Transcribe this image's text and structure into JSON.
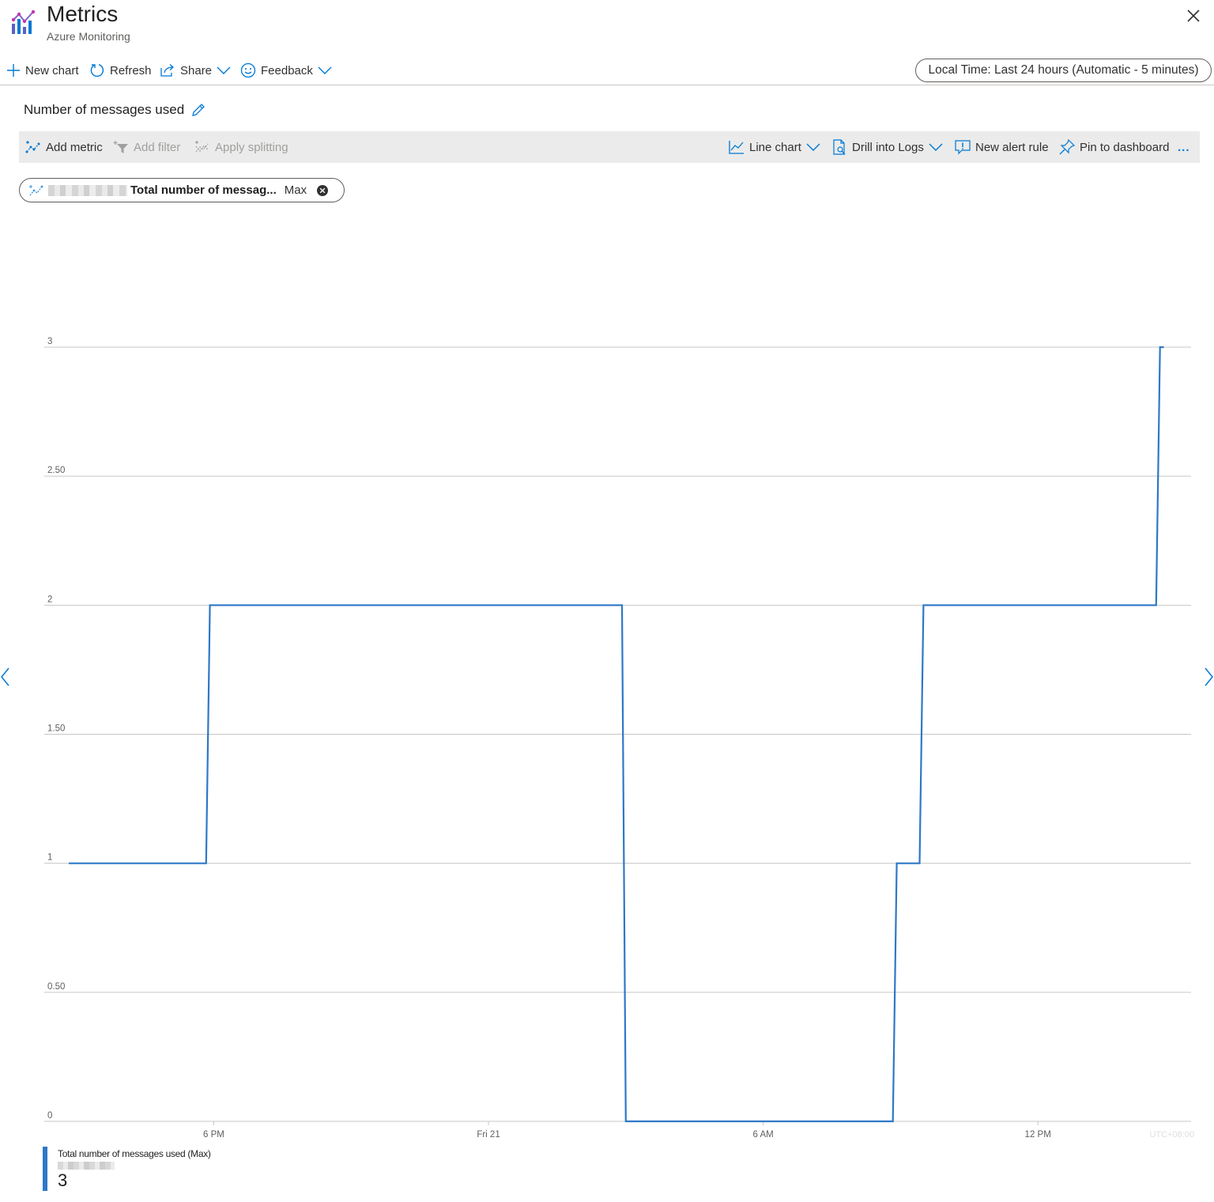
{
  "header": {
    "title": "Metrics",
    "subtitle": "Azure Monitoring"
  },
  "commands": {
    "new_chart": "New chart",
    "refresh": "Refresh",
    "share": "Share",
    "feedback": "Feedback",
    "time_range": "Local Time: Last 24 hours (Automatic - 5 minutes)"
  },
  "chart_title": "Number of messages used",
  "toolbar": {
    "add_metric": "Add metric",
    "add_filter": "Add filter",
    "apply_splitting": "Apply splitting",
    "line_chart": "Line chart",
    "drill_into_logs": "Drill into Logs",
    "new_alert_rule": "New alert rule",
    "pin_to_dashboard": "Pin to dashboard",
    "more": "..."
  },
  "metric_pill": {
    "metric": "Total number of messag...",
    "aggregation": "Max"
  },
  "colors": {
    "series": "#2e78c7",
    "gridline": "#c8c6c4",
    "accent": "#0078d4"
  },
  "chart_data": {
    "type": "line",
    "title": "Number of messages used",
    "xlabel": "",
    "ylabel": "",
    "x_ticks": [
      "6 PM",
      "Fri 21",
      "6 AM",
      "12 PM"
    ],
    "y_ticks": [
      "0",
      "0.50",
      "1",
      "1.50",
      "2",
      "2.50",
      "3"
    ],
    "ylim": [
      0,
      3
    ],
    "timezone_label": "UTC+08:00",
    "grid": true,
    "step": true,
    "series": [
      {
        "name": "Total number of messages used (Max)",
        "color": "#2e78c7",
        "points": [
          {
            "t": "2:50 PM",
            "v": 1
          },
          {
            "t": "5:50 PM",
            "v": 1
          },
          {
            "t": "5:55 PM",
            "v": 2
          },
          {
            "t": "2:55 AM",
            "v": 2
          },
          {
            "t": "3:00 AM",
            "v": 0
          },
          {
            "t": "8:50 AM",
            "v": 0
          },
          {
            "t": "8:55 AM",
            "v": 1
          },
          {
            "t": "9:25 AM",
            "v": 1
          },
          {
            "t": "9:30 AM",
            "v": 2
          },
          {
            "t": "2:35 PM",
            "v": 2
          },
          {
            "t": "2:40 PM",
            "v": 3
          },
          {
            "t": "2:45 PM",
            "v": 3
          }
        ]
      }
    ],
    "legend": {
      "placement": "bottom-left",
      "label": "Total number of messages used (Max)",
      "value": "3"
    }
  }
}
